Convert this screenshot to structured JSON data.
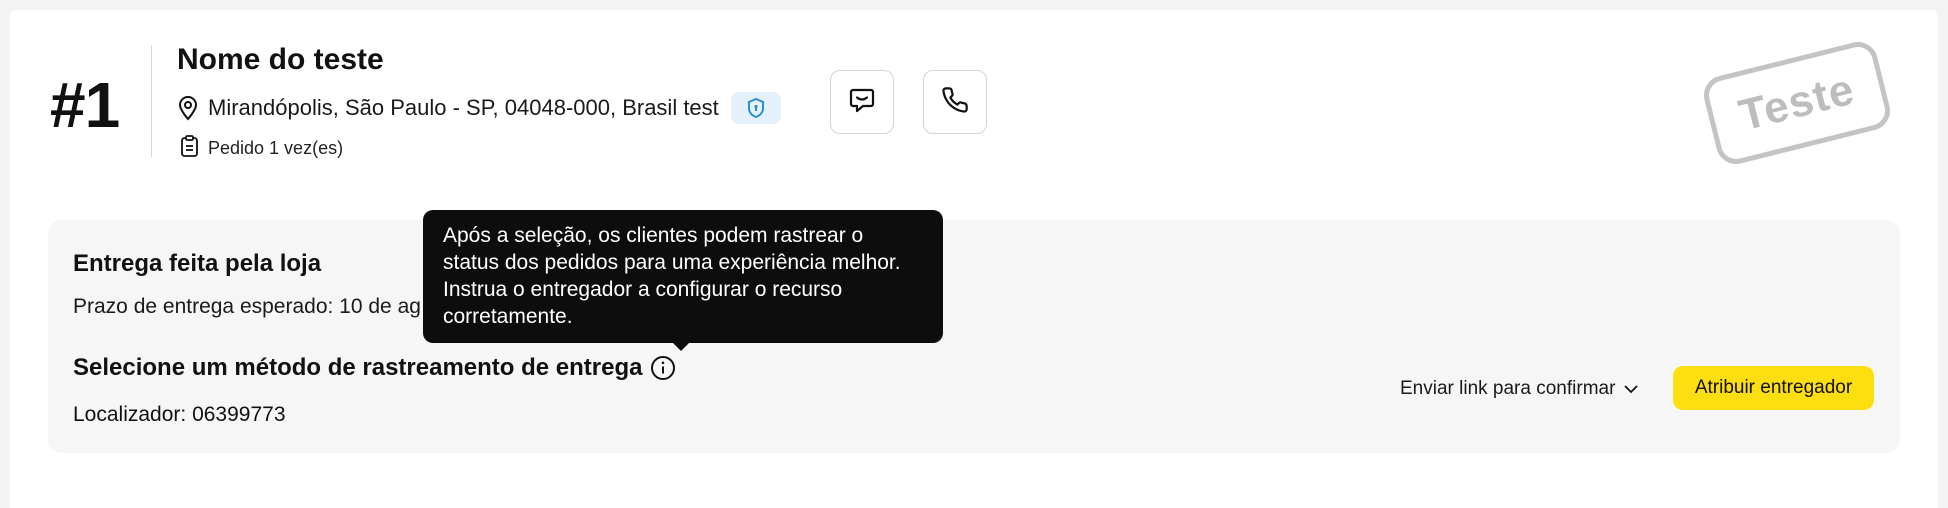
{
  "order": {
    "number": "#1",
    "customer_name": "Nome do teste",
    "address": "Mirandópolis, São Paulo - SP, 04048-000, Brasil test",
    "order_count": "Pedido 1 vez(es)",
    "stamp_label": "Teste"
  },
  "icons": {
    "location": "map-pin-icon",
    "verified": "shield-icon",
    "orders": "clipboard-icon",
    "chat": "chat-bubble-icon",
    "phone": "phone-icon",
    "info": "info-icon",
    "chevron": "chevron-down-icon"
  },
  "delivery": {
    "title": "Entrega feita pela loja",
    "deadline": "Prazo de entrega esperado: 10 de ag",
    "tracking_title": "Selecione um método de rastreamento de entrega",
    "locator": "Localizador: 06399773",
    "send_link_label": "Enviar link para confirmar",
    "assign_label": "Atribuir entregador"
  },
  "tooltip": {
    "text": "Após a seleção, os clientes podem rastrear o status dos pedidos para uma experiência melhor. Instrua o entregador a configurar o recurso corretamente."
  },
  "colors": {
    "accent_yellow": "#fddf11",
    "badge_blue": "#e4f1fa",
    "tooltip_bg": "#0d0d0d",
    "stamp_gray": "#c4c4c4"
  }
}
